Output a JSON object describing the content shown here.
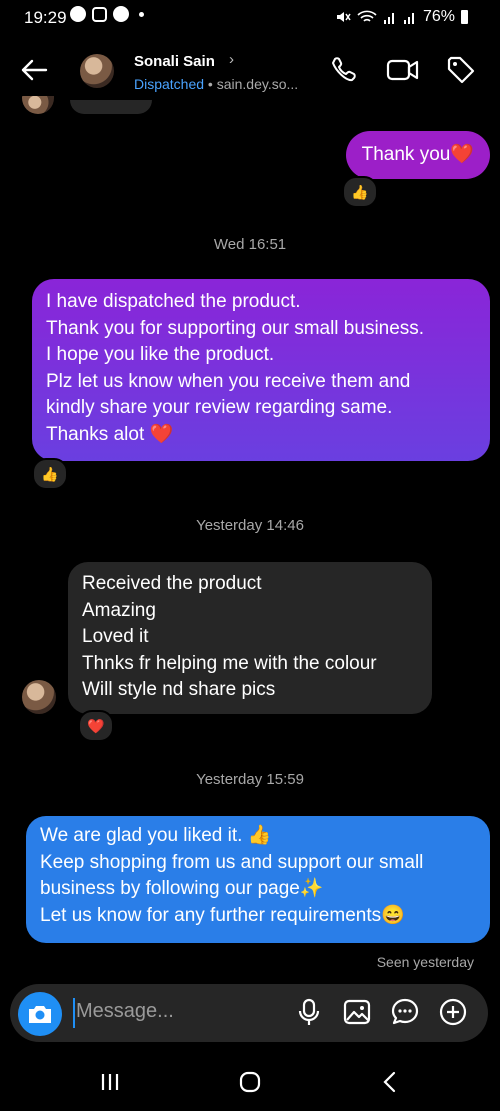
{
  "status_bar": {
    "time": "19:29",
    "battery": "76%"
  },
  "header": {
    "name": "Sonali Sain",
    "chevron": "›",
    "status": "Dispatched",
    "separator": " • ",
    "handle": "sain.dey.so..."
  },
  "messages": [
    {
      "lines": [
        "Thank you❤️"
      ],
      "reaction": "👍"
    },
    {
      "timestamp": "Wed 16:51",
      "lines": [
        "I have dispatched the product.",
        "Thank you for supporting our small business.",
        "I hope you like the product.",
        "Plz let us know when you receive them and",
        "kindly share your review regarding same.",
        "Thanks alot ❤️"
      ],
      "reaction": "👍"
    },
    {
      "timestamp": "Yesterday 14:46",
      "lines": [
        "Received the product",
        "Amazing",
        "Loved it",
        "Thnks fr helping me with the colour",
        "Will style nd share pics"
      ],
      "reaction": "❤️"
    },
    {
      "timestamp": "Yesterday 15:59",
      "lines": [
        "We are glad you liked it. 👍",
        "Keep shopping from us and support our small",
        "business by following our page✨",
        "Let us know for any further requirements😄"
      ]
    }
  ],
  "seen": "Seen yesterday",
  "composer": {
    "placeholder": "Message..."
  },
  "colors": {
    "accent_blue": "#1f8ff5",
    "purple_bubble": "#9c1fc8",
    "blue_bubble": "#2a7ee8",
    "incoming_bubble": "#262626"
  }
}
